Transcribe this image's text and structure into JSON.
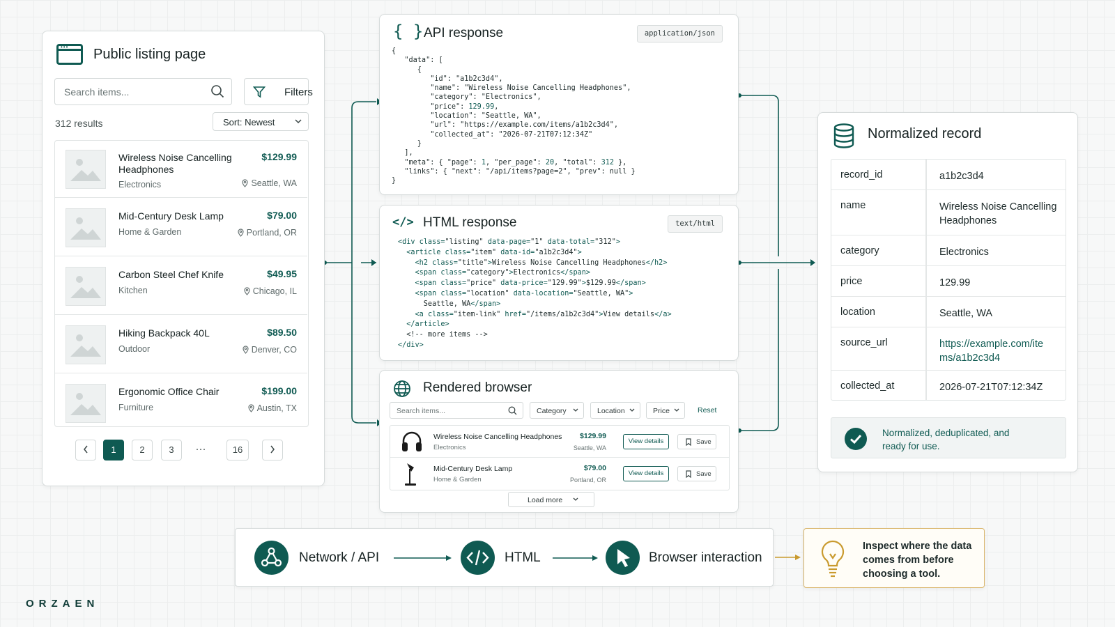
{
  "listing": {
    "title": "Public listing page",
    "search_placeholder": "Search items...",
    "filters_label": "Filters",
    "results_count": "312 results",
    "sort_label": "Sort: Newest",
    "items": [
      {
        "name": "Wireless Noise Cancelling Headphones",
        "category": "Electronics",
        "price": "$129.99",
        "location": "Seattle, WA"
      },
      {
        "name": "Mid-Century Desk Lamp",
        "category": "Home & Garden",
        "price": "$79.00",
        "location": "Portland, OR"
      },
      {
        "name": "Carbon Steel Chef Knife",
        "category": "Kitchen",
        "price": "$49.95",
        "location": "Chicago, IL"
      },
      {
        "name": "Hiking Backpack 40L",
        "category": "Outdoor",
        "price": "$89.50",
        "location": "Denver, CO"
      },
      {
        "name": "Ergonomic Office Chair",
        "category": "Furniture",
        "price": "$199.00",
        "location": "Austin, TX"
      }
    ],
    "pagination": {
      "pages": [
        "1",
        "2",
        "3",
        "···",
        "16"
      ],
      "current": "1"
    }
  },
  "api": {
    "title": "API response",
    "tag": "application/json"
  },
  "html_response": {
    "title": "HTML response",
    "tag": "text/html"
  },
  "browser": {
    "title": "Rendered browser",
    "search_placeholder": "Search items...",
    "filters": [
      "Category",
      "Location",
      "Price"
    ],
    "reset_label": "Reset",
    "rows": [
      {
        "name": "Wireless Noise Cancelling Headphones",
        "category": "Electronics",
        "price": "$129.99",
        "location": "Seattle, WA"
      },
      {
        "name": "Mid-Century Desk Lamp",
        "category": "Home & Garden",
        "price": "$79.00",
        "location": "Portland, OR"
      }
    ],
    "view_label": "View details",
    "save_label": "Save",
    "load_more_label": "Load more"
  },
  "record": {
    "title": "Normalized record",
    "rows": [
      {
        "key": "record_id",
        "value": "a1b2c3d4"
      },
      {
        "key": "name",
        "value": "Wireless Noise Cancelling Headphones"
      },
      {
        "key": "category",
        "value": "Electronics"
      },
      {
        "key": "price",
        "value": "129.99"
      },
      {
        "key": "location",
        "value": "Seattle, WA"
      },
      {
        "key": "source_url",
        "value": "https://example.com/items/a1b2c3d4"
      },
      {
        "key": "collected_at",
        "value": "2026-07-21T07:12:34Z"
      }
    ],
    "status": "Normalized, deduplicated, and ready for use."
  },
  "flow": {
    "steps": [
      "Network / API",
      "HTML",
      "Browser interaction"
    ],
    "tip": "Inspect where the data comes from before choosing a tool."
  },
  "brand": "ORZAEN",
  "colors": {
    "accent": "#0f5a52",
    "tip_border": "#d9b56a",
    "tip_icon": "#c99a2e"
  }
}
